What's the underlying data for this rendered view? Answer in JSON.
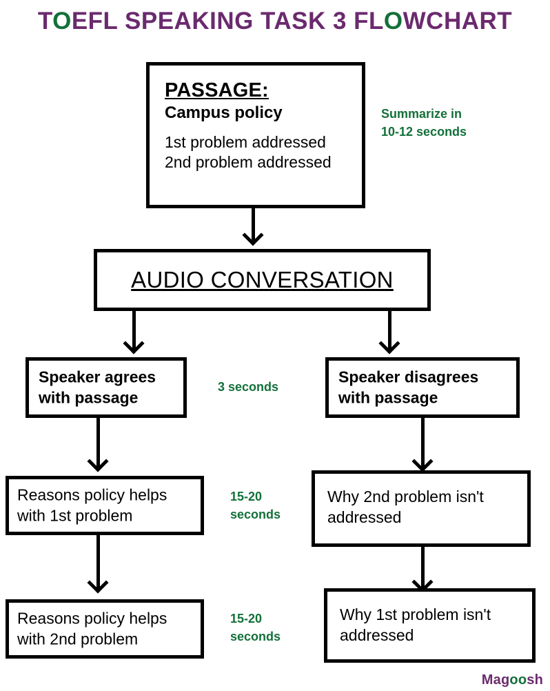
{
  "title": {
    "full": "TOEFL SPEAKING TASK 3 FLOWCHART",
    "p1": "T",
    "g1": "O",
    "p2": "EFL SPEAKING TASK 3 FL",
    "g2": "O",
    "p3": "WCHART",
    "color_purple": "#6b2a6e",
    "color_green": "#13703a"
  },
  "boxes": {
    "passage": {
      "heading": "PASSAGE:",
      "subheading": "Campus policy",
      "line1": "1st problem addressed",
      "line2": "2nd problem addressed"
    },
    "audio": {
      "label": "AUDIO CONVERSATION"
    },
    "agree": {
      "line1": "Speaker agrees",
      "line2": "with passage"
    },
    "disagree": {
      "line1": "Speaker disagrees",
      "line2": "with passage"
    },
    "reasons_1st": {
      "line1": "Reasons policy helps",
      "line2": "with 1st problem"
    },
    "reasons_2nd": {
      "line1": "Reasons policy helps",
      "line2": "with 2nd problem"
    },
    "why_2nd": {
      "line1": "Why 2nd problem isn't",
      "line2": "addressed"
    },
    "why_1st": {
      "line1": "Why 1st problem isn't",
      "line2": "addressed"
    }
  },
  "notes": {
    "summarize": {
      "line1": "Summarize in",
      "line2": "10-12 seconds"
    },
    "three_seconds": {
      "line1": "3 seconds",
      "line2": ""
    },
    "fifteen_twenty_a": {
      "line1": "15-20",
      "line2": "seconds"
    },
    "fifteen_twenty_b": {
      "line1": "15-20",
      "line2": "seconds"
    }
  },
  "logo": {
    "p1": "Mag",
    "g1": "oo",
    "p2": "sh",
    "full": "Magoosh"
  }
}
